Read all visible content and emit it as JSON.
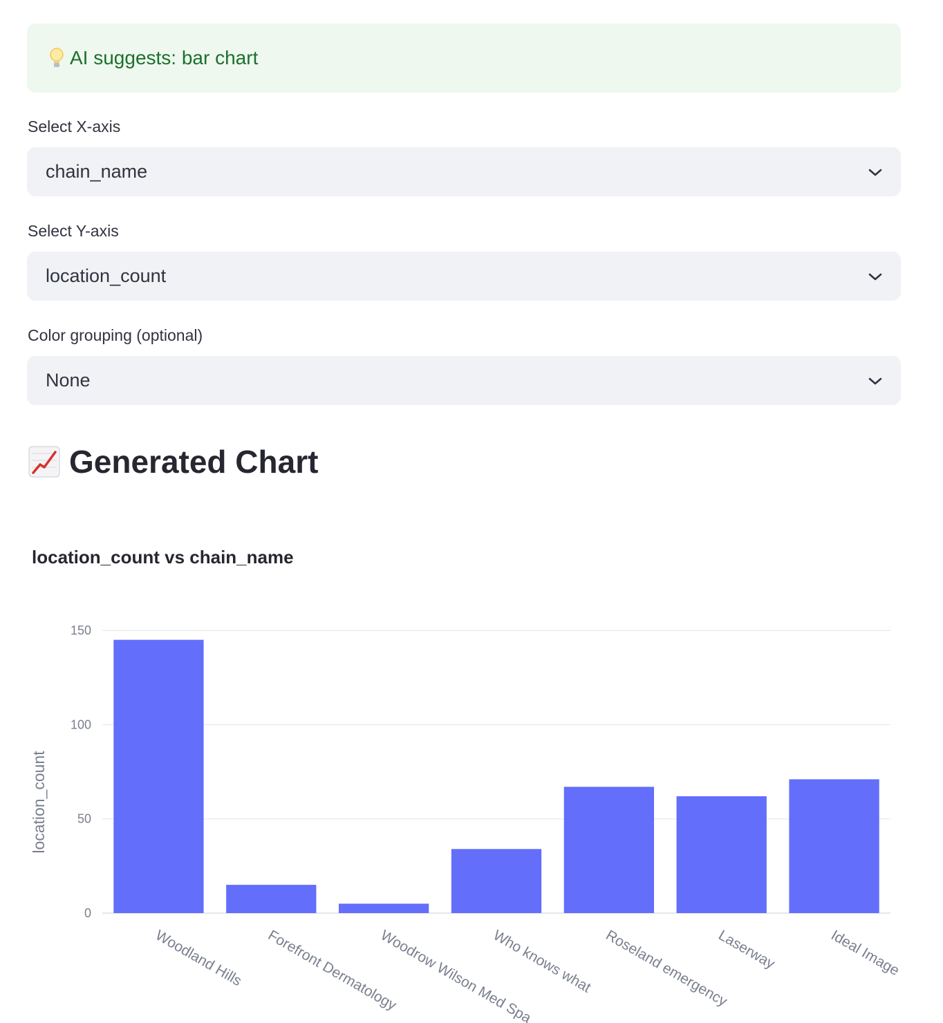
{
  "suggestion": {
    "icon": "lightbulb-icon",
    "text": "AI suggests: bar chart"
  },
  "x_axis_select": {
    "label": "Select X-axis",
    "value": "chain_name"
  },
  "y_axis_select": {
    "label": "Select Y-axis",
    "value": "location_count"
  },
  "color_select": {
    "label": "Color grouping (optional)",
    "value": "None"
  },
  "section": {
    "icon": "chart-increasing-icon",
    "title": "Generated Chart"
  },
  "colors": {
    "bar": "#636efa",
    "grid": "#e5e7ec",
    "suggest_bg": "#eef8ee",
    "suggest_text": "#1d6f2e"
  },
  "chart_data": {
    "type": "bar",
    "title": "location_count vs chain_name",
    "xlabel": "",
    "ylabel": "location_count",
    "categories": [
      "Woodland Hills",
      "Forefront Dermatology",
      "Woodrow Wilson Med Spa",
      "Who knows what",
      "Roseland emergency",
      "Laserway",
      "Ideal Image"
    ],
    "values": [
      145,
      15,
      5,
      34,
      67,
      62,
      71
    ],
    "ylim": [
      0,
      150
    ],
    "yticks": [
      0,
      50,
      100,
      150
    ],
    "grid": true
  }
}
